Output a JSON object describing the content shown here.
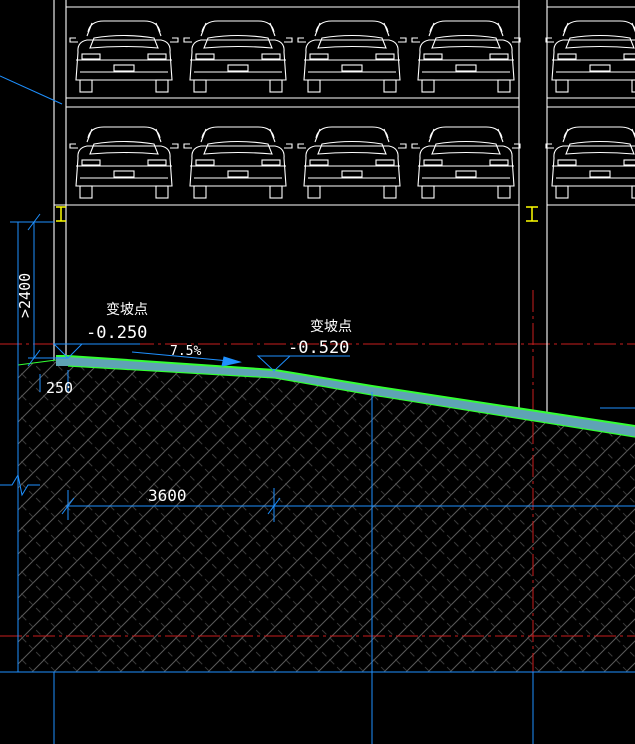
{
  "drawing": {
    "colors": {
      "background": "#000000",
      "structure": "#ffffff",
      "dimension": "#1e90ff",
      "axis": "#c81e1e",
      "ramp_fill": "#5fa3b5",
      "ramp_edge": "#33ff33",
      "column_marker": "#ffff00",
      "hatch": "#5a5a5a"
    },
    "breakpoint_1": {
      "label": "变坡点",
      "elevation": "-0.250"
    },
    "breakpoint_2": {
      "label": "变坡点",
      "elevation": "-0.520"
    },
    "slope": {
      "value": "7.5%"
    },
    "dimensions": {
      "clear_height": ">2400",
      "offset": "250",
      "span": "3600"
    },
    "parking": {
      "rows": 2,
      "cars_per_row_visible": 5
    }
  }
}
